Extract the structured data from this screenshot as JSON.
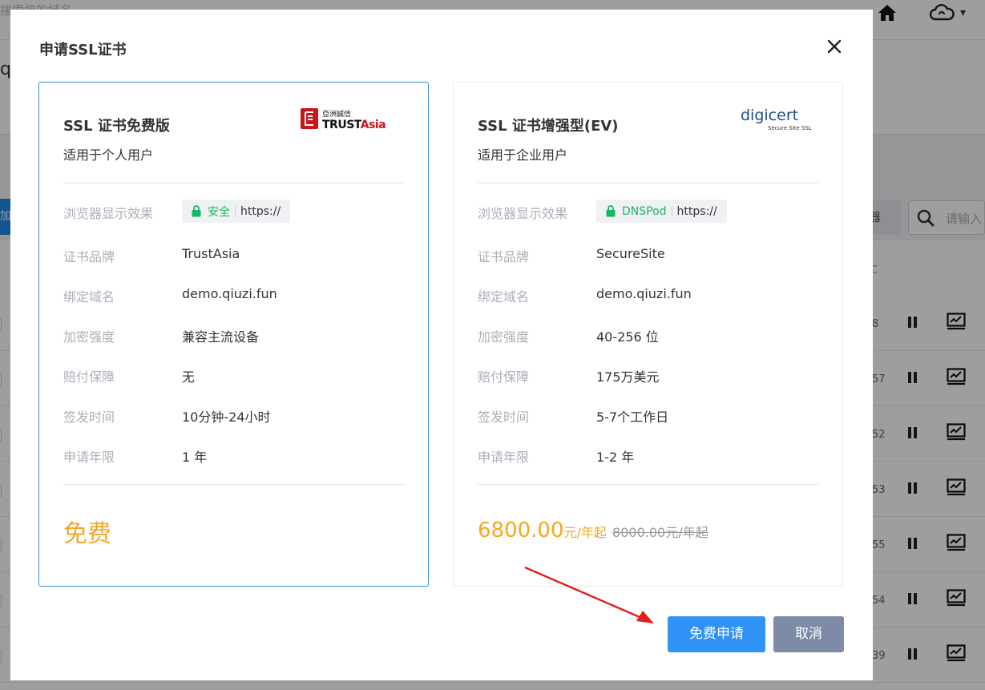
{
  "background": {
    "search_placeholder": "搜索您的域名",
    "left_partial_text": "q",
    "blue_button_label": "加",
    "filter_button_label": "器",
    "search_input_placeholder": "请输入",
    "row_numbers": [
      "8",
      "57",
      "52",
      "53",
      "55",
      "54",
      "39"
    ]
  },
  "dialog": {
    "title": "申请SSL证书",
    "cards": [
      {
        "title": "SSL 证书免费版",
        "subtitle": "适用于个人用户",
        "logo": "TrustAsia",
        "logo_cn": "亞洲誠信",
        "browser_label": "浏览器显示效果",
        "browser_badge": "安全",
        "browser_url": "https://",
        "rows": [
          {
            "label": "证书品牌",
            "value": "TrustAsia"
          },
          {
            "label": "绑定域名",
            "value": "demo.qiuzi.fun"
          },
          {
            "label": "加密强度",
            "value": "兼容主流设备"
          },
          {
            "label": "赔付保障",
            "value": "无"
          },
          {
            "label": "签发时间",
            "value": "10分钟-24小时"
          },
          {
            "label": "申请年限",
            "value": "1 年"
          }
        ],
        "price": "免费",
        "selected": true
      },
      {
        "title": "SSL 证书增强型(EV)",
        "subtitle": "适用于企业用户",
        "logo": "digicert",
        "logo_sub": "Secure Site SSL",
        "browser_label": "浏览器显示效果",
        "browser_badge": "DNSPod",
        "browser_url": "https://",
        "rows": [
          {
            "label": "证书品牌",
            "value": "SecureSite"
          },
          {
            "label": "绑定域名",
            "value": "demo.qiuzi.fun"
          },
          {
            "label": "加密强度",
            "value": "40-256 位"
          },
          {
            "label": "赔付保障",
            "value": "175万美元"
          },
          {
            "label": "签发时间",
            "value": "5-7个工作日"
          },
          {
            "label": "申请年限",
            "value": "1-2 年"
          }
        ],
        "price": "6800.00",
        "price_unit": "元/年起",
        "original_price": "8000.00元/年起",
        "selected": false
      }
    ],
    "buttons": {
      "apply": "免费申请",
      "cancel": "取消"
    }
  },
  "colors": {
    "accent": "#2f93f5",
    "price": "#f5a623",
    "secure_green": "#15b860",
    "cancel_btn": "#7d8ba6",
    "annotation_arrow": "#e02020"
  }
}
